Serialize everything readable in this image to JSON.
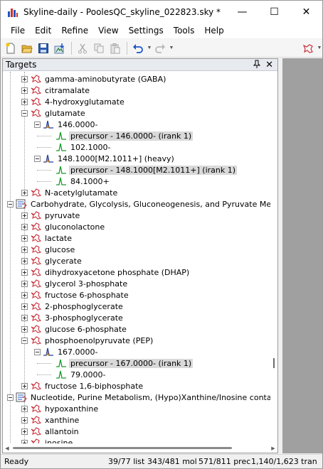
{
  "window": {
    "title": "Skyline-daily - PoolesQC_skyline_022823.sky *",
    "minimize_glyph": "—",
    "maximize_glyph": "☐",
    "close_glyph": "✕"
  },
  "menu": [
    "File",
    "Edit",
    "Refine",
    "View",
    "Settings",
    "Tools",
    "Help"
  ],
  "toolbar": {
    "buttons": [
      "new-document",
      "open-folder",
      "save",
      "import-data",
      "cut",
      "copy",
      "paste",
      "undo",
      "redo",
      "peptide-settings"
    ]
  },
  "targets_pane": {
    "title": "Targets",
    "pin_glyph": "📌",
    "close_glyph": "✕"
  },
  "tree": [
    {
      "level": 2,
      "type": "molecule",
      "label": "gamma-aminobutyrate (GABA)",
      "expander": "plus"
    },
    {
      "level": 2,
      "type": "molecule",
      "label": "citramalate",
      "expander": "plus"
    },
    {
      "level": 2,
      "type": "molecule",
      "label": "4-hydroxyglutamate",
      "expander": "plus"
    },
    {
      "level": 2,
      "type": "molecule",
      "label": "glutamate",
      "expander": "minus"
    },
    {
      "level": 3,
      "type": "precursor",
      "label": "146.0000-",
      "expander": "minus"
    },
    {
      "level": 4,
      "type": "transition",
      "label": "precursor - 146.0000- (irank 1)",
      "highlight": true
    },
    {
      "level": 4,
      "type": "transition",
      "label": "102.1000-"
    },
    {
      "level": 3,
      "type": "precursor",
      "label": "148.1000[M2.1011+] (heavy)",
      "expander": "minus"
    },
    {
      "level": 4,
      "type": "transition",
      "label": "precursor - 148.1000[M2.1011+] (irank 1)",
      "highlight": true
    },
    {
      "level": 4,
      "type": "transition",
      "label": "84.1000+"
    },
    {
      "level": 2,
      "type": "molecule",
      "label": "N-acetylglutamate",
      "expander": "plus"
    },
    {
      "level": 1,
      "type": "list",
      "label": "Carbohydrate, Glycolysis, Gluconeogenesis, and Pyruvate Metabolism",
      "expander": "minus"
    },
    {
      "level": 2,
      "type": "molecule",
      "label": "pyruvate",
      "expander": "plus"
    },
    {
      "level": 2,
      "type": "molecule",
      "label": "gluconolactone",
      "expander": "plus"
    },
    {
      "level": 2,
      "type": "molecule",
      "label": "lactate",
      "expander": "plus"
    },
    {
      "level": 2,
      "type": "molecule",
      "label": "glucose",
      "expander": "plus"
    },
    {
      "level": 2,
      "type": "molecule",
      "label": "glycerate",
      "expander": "plus"
    },
    {
      "level": 2,
      "type": "molecule",
      "label": "dihydroxyacetone phosphate (DHAP)",
      "expander": "plus"
    },
    {
      "level": 2,
      "type": "molecule",
      "label": "glycerol 3-phosphate",
      "expander": "plus"
    },
    {
      "level": 2,
      "type": "molecule",
      "label": "fructose 6-phosphate",
      "expander": "plus"
    },
    {
      "level": 2,
      "type": "molecule",
      "label": "2-phosphoglycerate",
      "expander": "plus"
    },
    {
      "level": 2,
      "type": "molecule",
      "label": "3-phosphoglycerate",
      "expander": "plus"
    },
    {
      "level": 2,
      "type": "molecule",
      "label": "glucose 6-phosphate",
      "expander": "plus"
    },
    {
      "level": 2,
      "type": "molecule",
      "label": "phosphoenolpyruvate (PEP)",
      "expander": "minus"
    },
    {
      "level": 3,
      "type": "precursor",
      "label": "167.0000-",
      "expander": "minus"
    },
    {
      "level": 4,
      "type": "transition",
      "label": "precursor - 167.0000- (irank 1)",
      "highlight": true
    },
    {
      "level": 4,
      "type": "transition",
      "label": "79.0000-"
    },
    {
      "level": 2,
      "type": "molecule",
      "label": "fructose 1,6-biphosphate",
      "expander": "plus"
    },
    {
      "level": 1,
      "type": "list",
      "label": "Nucleotide, Purine Metabolism, (Hypo)Xanthine/Inosine containing",
      "expander": "minus"
    },
    {
      "level": 2,
      "type": "molecule",
      "label": "hypoxanthine",
      "expander": "plus"
    },
    {
      "level": 2,
      "type": "molecule",
      "label": "xanthine",
      "expander": "plus"
    },
    {
      "level": 2,
      "type": "molecule",
      "label": "allantoin",
      "expander": "plus"
    },
    {
      "level": 2,
      "type": "molecule",
      "label": "inosine",
      "expander": "plus"
    }
  ],
  "vertical_scroll_fraction": 0.79,
  "horizontal_scroll_fraction": 0.85,
  "status": {
    "ready": "Ready",
    "lists": "39/77 list",
    "molecules": "343/481 mol",
    "precursors": "571/811 prec",
    "transitions": "1,140/1,623 tran"
  },
  "colors": {
    "molecule_icon": "#c8323c",
    "chromatogram_green": "#1a9a2a",
    "precursor_blue": "#1b3fb0",
    "precursor_orange": "#e08a00",
    "highlight": "#d9d9d9",
    "right_panel": "#a0a0a0"
  }
}
